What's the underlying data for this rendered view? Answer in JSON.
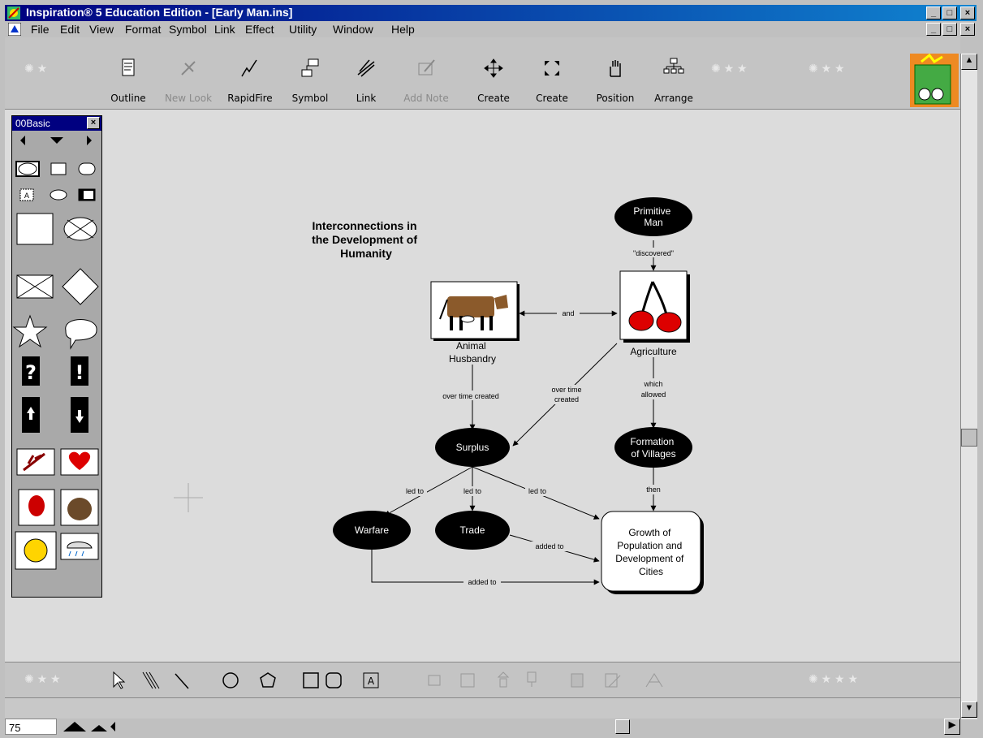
{
  "window": {
    "title": "Inspiration® 5 Education Edition - [Early Man.ins]",
    "controls": [
      "_",
      "□",
      "×"
    ]
  },
  "menu": [
    "File",
    "Edit",
    "View",
    "Format",
    "Symbol",
    "Link",
    "Effect",
    "Utility",
    "Window",
    "Help"
  ],
  "toolbar": [
    {
      "label": "Outline",
      "icon": "outline-icon",
      "enabled": true
    },
    {
      "label": "New Look",
      "icon": "new-look-icon",
      "enabled": false
    },
    {
      "label": "RapidFire",
      "icon": "rapidfire-icon",
      "enabled": true
    },
    {
      "label": "Symbol",
      "icon": "symbol-icon",
      "enabled": true
    },
    {
      "label": "Link",
      "icon": "link-icon",
      "enabled": true
    },
    {
      "label": "Add Note",
      "icon": "add-note-icon",
      "enabled": false
    },
    {
      "label": "Create",
      "icon": "create-arrows-icon",
      "enabled": true
    },
    {
      "label": "Create",
      "icon": "create-expand-icon",
      "enabled": true
    },
    {
      "label": "Position",
      "icon": "hand-icon",
      "enabled": true
    },
    {
      "label": "Arrange",
      "icon": "arrange-icon",
      "enabled": true
    }
  ],
  "palette": {
    "title": "00Basic",
    "close": "×"
  },
  "diagram": {
    "heading": [
      "Interconnections in",
      "the Development of",
      "Humanity"
    ],
    "nodes": {
      "primitive_man": [
        "Primitive",
        "Man"
      ],
      "animal_husbandry": [
        "Animal",
        "Husbandry"
      ],
      "agriculture": "Agriculture",
      "surplus": "Surplus",
      "formation_villages": [
        "Formation",
        "of Villages"
      ],
      "warfare": "Warfare",
      "trade": "Trade",
      "growth": [
        "Growth of",
        "Population and",
        "Development of",
        "Cities"
      ]
    },
    "links": {
      "discovered": "\"discovered\"",
      "and": "and",
      "over_time_created_left": "over time created",
      "over_time_created_right": [
        "over time",
        "created"
      ],
      "which_allowed": [
        "which",
        "allowed"
      ],
      "led_to_1": "led to",
      "led_to_2": "led to",
      "led_to_3": "led to",
      "then": "then",
      "added_to_1": "added to",
      "added_to_2": "added to"
    }
  },
  "status": {
    "zoom": "75"
  },
  "colors": {
    "titlebar": "#000080",
    "node_fill": "#000000",
    "canvas": "#dcdcdc"
  }
}
